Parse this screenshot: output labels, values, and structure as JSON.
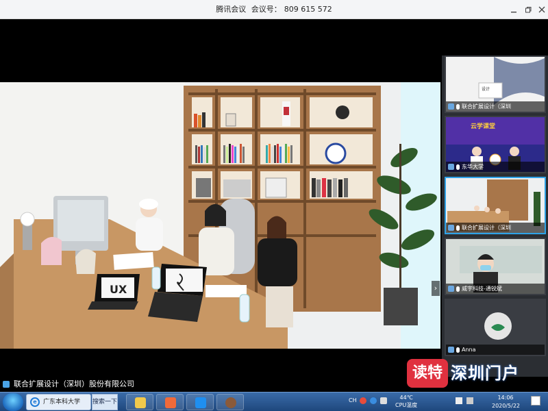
{
  "window": {
    "app_name": "腾讯会议",
    "meeting_label": "会议号：",
    "meeting_id": "809 615 572",
    "controls": [
      "minimize",
      "restore",
      "close"
    ]
  },
  "main_speaker": {
    "name": "联合扩展设计（深圳）股份有限公司"
  },
  "participants": [
    {
      "name": "联合扩展设计（深圳",
      "active": false
    },
    {
      "name": "东华大学",
      "active": false
    },
    {
      "name": "联合扩展设计（深圳",
      "active": true
    },
    {
      "name": "威宇科技-通锐斌",
      "active": false
    },
    {
      "name": "Anna",
      "active": false
    }
  ],
  "watermark": {
    "badge": "读特",
    "text": "深圳门户"
  },
  "taskbar": {
    "ie_label": "广东本科大学",
    "search_label": "搜索一下",
    "temp": "44℃",
    "cpu_label": "CPU温度",
    "time": "14:06",
    "date": "2020/5/22",
    "lang": "CH"
  },
  "colors": {
    "accent": "#2ea3e8",
    "taskbar_top": "#3a6ba8",
    "watermark_red": "#e0313f"
  }
}
